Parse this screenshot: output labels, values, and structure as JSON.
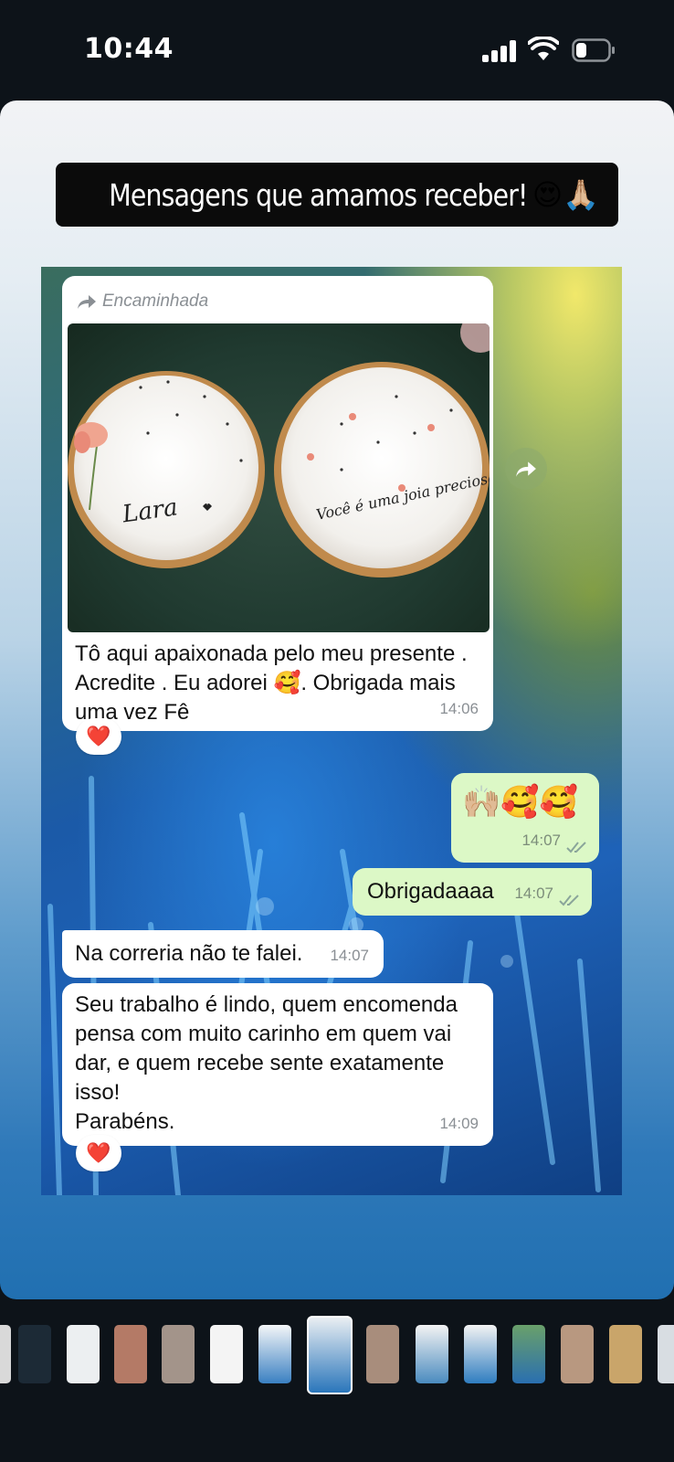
{
  "status_bar": {
    "time": "10:44"
  },
  "headline": {
    "text": "Mensagens que amamos receber!",
    "emoji": "😍🙏🏼"
  },
  "chat": {
    "forwarded_label": "Encaminhada",
    "photo": {
      "plate_left_text": "Lara",
      "plate_right_text": "Você é uma joia preciosa!"
    },
    "messages": [
      {
        "direction": "in",
        "text": "Tô aqui apaixonada pelo meu presente .\nAcredite . Eu adorei 🥰. Obrigada mais\numa vez Fê",
        "time": "14:06",
        "reaction": "❤️"
      },
      {
        "direction": "out",
        "text": "🙌🏼🥰🥰",
        "time": "14:07"
      },
      {
        "direction": "out",
        "text": "Obrigadaaaa",
        "time": "14:07"
      },
      {
        "direction": "in",
        "text": "Na correria não te falei.",
        "time": "14:07"
      },
      {
        "direction": "in",
        "text": "Seu trabalho é lindo, quem encomenda\npensa com muito carinho em quem vai\ndar, e quem recebe sente exatamente\nisso!\nParabéns.",
        "time": "14:09",
        "reaction": "❤️"
      }
    ]
  },
  "colors": {
    "incoming_bubble": "#ffffff",
    "outgoing_bubble": "#dcf8c6",
    "headline_bg": "#0b0b0b"
  },
  "thumbnails": {
    "count": 15,
    "active_index": 6
  }
}
